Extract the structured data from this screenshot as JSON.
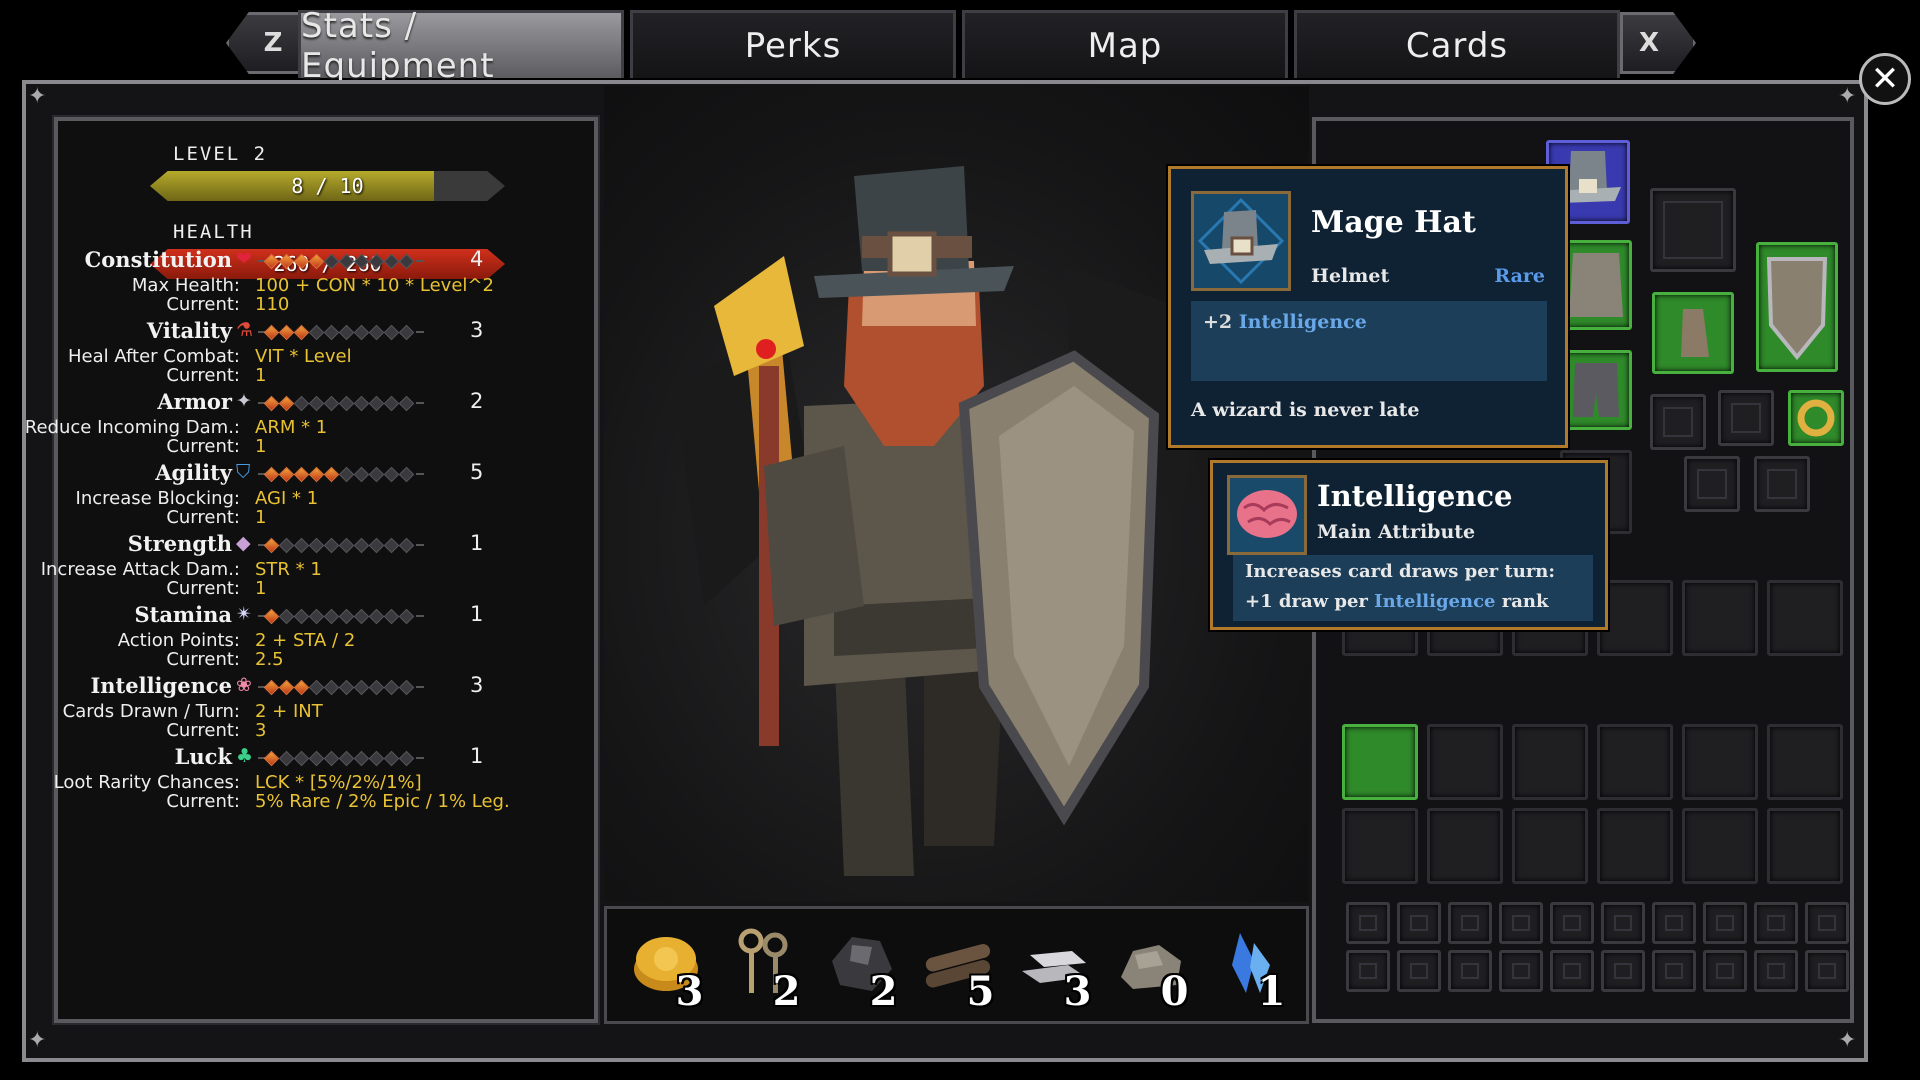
{
  "tabs": [
    {
      "label": "Stats / Equipment",
      "active": true
    },
    {
      "label": "Perks",
      "active": false
    },
    {
      "label": "Map",
      "active": false
    },
    {
      "label": "Cards",
      "active": false
    }
  ],
  "keys": {
    "prev": "Z",
    "next": "X"
  },
  "close_label": "✕",
  "level": {
    "label": "LEVEL 2",
    "text": "8 / 10",
    "fraction": 0.8
  },
  "health": {
    "label": "HEALTH",
    "text": "260 / 260",
    "fraction": 1.0
  },
  "stats": [
    {
      "name": "Constitution",
      "icon": "heart-icon",
      "glyph": "❤",
      "color": "#e0243a",
      "rank": 4,
      "lines": [
        [
          "Max Health:",
          "100 + CON * 10 * Level^2"
        ],
        [
          "Current:",
          "110"
        ]
      ]
    },
    {
      "name": "Vitality",
      "icon": "potion-icon",
      "glyph": "⚗",
      "color": "#e04a3a",
      "rank": 3,
      "lines": [
        [
          "Heal After Combat:",
          "VIT * Level"
        ],
        [
          "Current:",
          "1"
        ]
      ]
    },
    {
      "name": "Armor",
      "icon": "armor-icon",
      "glyph": "✦",
      "color": "#c8c8d0",
      "rank": 2,
      "lines": [
        [
          "Reduce Incoming Dam.:",
          "ARM * 1"
        ],
        [
          "Current:",
          "1"
        ]
      ]
    },
    {
      "name": "Agility",
      "icon": "shield-icon",
      "glyph": "⛉",
      "color": "#4a9ae0",
      "rank": 5,
      "lines": [
        [
          "Increase Blocking:",
          "AGI * 1"
        ],
        [
          "Current:",
          "1"
        ]
      ]
    },
    {
      "name": "Strength",
      "icon": "crystal-icon",
      "glyph": "◆",
      "color": "#c8a0d8",
      "rank": 1,
      "lines": [
        [
          "Increase Attack Dam.:",
          "STR * 1"
        ],
        [
          "Current:",
          "1"
        ]
      ]
    },
    {
      "name": "Stamina",
      "icon": "star-icon",
      "glyph": "✴",
      "color": "#d8d8ff",
      "rank": 1,
      "lines": [
        [
          "Action Points:",
          "2 + STA / 2"
        ],
        [
          "Current:",
          "2.5"
        ]
      ]
    },
    {
      "name": "Intelligence",
      "icon": "brain-icon",
      "glyph": "❀",
      "color": "#f08aa8",
      "rank": 3,
      "lines": [
        [
          "Cards Drawn / Turn:",
          "2 + INT"
        ],
        [
          "Current:",
          "3"
        ]
      ]
    },
    {
      "name": "Luck",
      "icon": "clover-icon",
      "glyph": "♣",
      "color": "#3ad08a",
      "rank": 1,
      "lines": [
        [
          "Loot Rarity Chances:",
          "LCK * [5%/2%/1%]"
        ],
        [
          "Current:",
          "5% Rare / 2% Epic / 1% Leg."
        ]
      ]
    }
  ],
  "max_rank": 10,
  "resources": [
    {
      "name": "gold-coins-icon",
      "count": "3"
    },
    {
      "name": "keys-icon",
      "count": "2"
    },
    {
      "name": "ore-icon",
      "count": "2"
    },
    {
      "name": "wood-logs-icon",
      "count": "5"
    },
    {
      "name": "iron-ingots-icon",
      "count": "3"
    },
    {
      "name": "stone-icon",
      "count": "0"
    },
    {
      "name": "crystal-icon",
      "count": "1"
    }
  ],
  "item_tooltip": {
    "title": "Mage Hat",
    "type": "Helmet",
    "rarity": "Rare",
    "bonus_prefix": "+2",
    "bonus_stat": "Intelligence",
    "flavor": "A wizard is never late"
  },
  "attr_tooltip": {
    "title": "Intelligence",
    "subtitle": "Main Attribute",
    "desc1": "Increases card draws per turn:",
    "desc2_prefix": "+1 draw per",
    "desc2_stat": "Intelligence",
    "desc2_suffix": "rank"
  },
  "colors": {
    "rare": "#5a9ae8",
    "highlight": "#6aa8e8",
    "stat_value": "#e8c232",
    "tooltip_border": "#b07a2a"
  }
}
